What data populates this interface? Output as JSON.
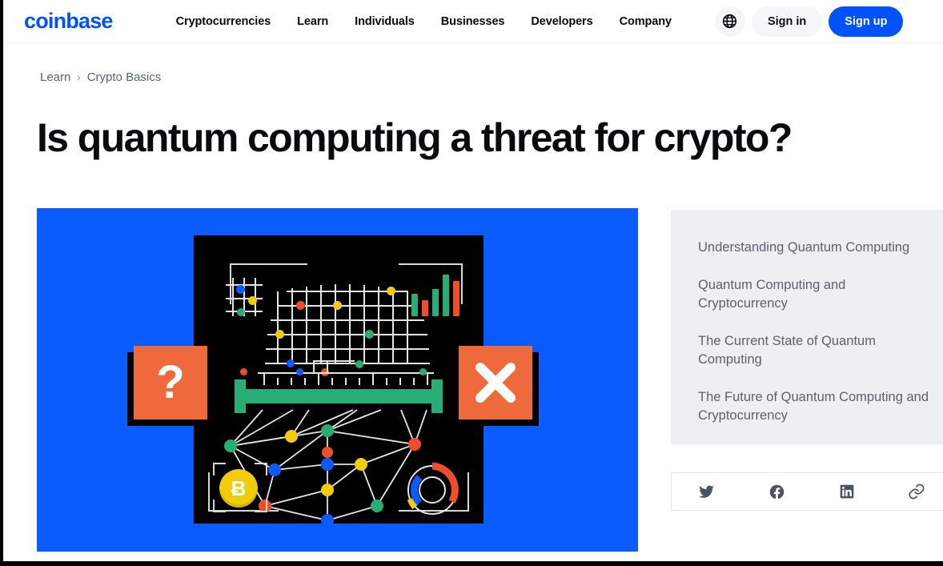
{
  "brand": {
    "name": "coinbase",
    "color": "#0052ff"
  },
  "nav": {
    "items": [
      {
        "label": "Cryptocurrencies",
        "name": "nav-cryptocurrencies"
      },
      {
        "label": "Learn",
        "name": "nav-learn"
      },
      {
        "label": "Individuals",
        "name": "nav-individuals"
      },
      {
        "label": "Businesses",
        "name": "nav-businesses"
      },
      {
        "label": "Developers",
        "name": "nav-developers"
      },
      {
        "label": "Company",
        "name": "nav-company"
      }
    ],
    "language_icon": "globe-icon",
    "sign_in_label": "Sign in",
    "sign_up_label": "Sign up"
  },
  "breadcrumb": {
    "parent": "Learn",
    "separator": "›",
    "current": "Crypto Basics"
  },
  "article": {
    "title": "Is quantum computing a threat for crypto?"
  },
  "toc": {
    "items": [
      "Understanding Quantum Computing",
      "Quantum Computing and Cryptocurrency",
      "The Current State of Quantum Computing",
      "The Future of Quantum Computing and Cryptocurrency"
    ]
  },
  "share": {
    "items": [
      {
        "network": "twitter",
        "icon": "twitter-icon"
      },
      {
        "network": "facebook",
        "icon": "facebook-icon"
      },
      {
        "network": "linkedin",
        "icon": "linkedin-icon"
      },
      {
        "network": "copy-link",
        "icon": "link-icon"
      }
    ]
  },
  "hero": {
    "alt": "Quantum computing illustration",
    "background_color": "#0a5cff",
    "panel_color": "#000000",
    "accent_color": "#ee6a3c",
    "question_mark": "?",
    "bitcoin_symbol": "Ƀ",
    "palette": {
      "blue": "#0a5cff",
      "orange": "#ee6a3c",
      "red": "#ef4e2b",
      "green": "#27ad75",
      "yellow": "#f2cb0b",
      "node_blue": "#0a5cff",
      "line": "#e3e5e7"
    },
    "bar_chart_values": [
      28,
      20,
      34,
      52,
      44
    ],
    "bar_chart_colors": [
      "#27ad75",
      "#ef4e2b",
      "#27ad75",
      "#27ad75",
      "#ef4e2b"
    ]
  }
}
